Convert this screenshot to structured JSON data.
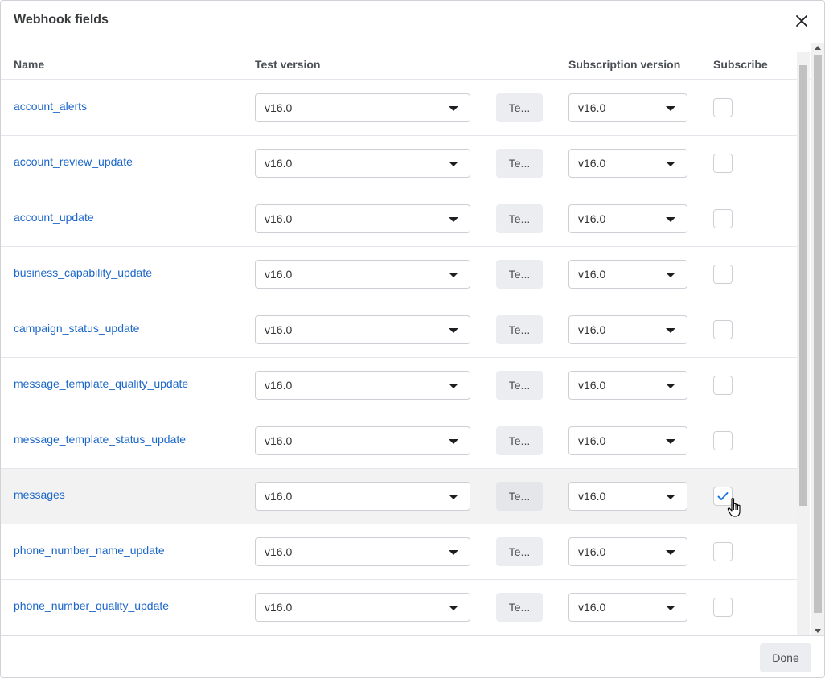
{
  "dialog": {
    "title": "Webhook fields",
    "done_label": "Done"
  },
  "columns": {
    "name": "Name",
    "test_version": "Test version",
    "subscription_version": "Subscription version",
    "subscribe": "Subscribe"
  },
  "rows": [
    {
      "name": "account_alerts",
      "test_version": "v16.0",
      "test_label": "Te...",
      "subscription_version": "v16.0",
      "subscribed": false
    },
    {
      "name": "account_review_update",
      "test_version": "v16.0",
      "test_label": "Te...",
      "subscription_version": "v16.0",
      "subscribed": false
    },
    {
      "name": "account_update",
      "test_version": "v16.0",
      "test_label": "Te...",
      "subscription_version": "v16.0",
      "subscribed": false
    },
    {
      "name": "business_capability_update",
      "test_version": "v16.0",
      "test_label": "Te...",
      "subscription_version": "v16.0",
      "subscribed": false
    },
    {
      "name": "campaign_status_update",
      "test_version": "v16.0",
      "test_label": "Te...",
      "subscription_version": "v16.0",
      "subscribed": false
    },
    {
      "name": "message_template_quality_update",
      "test_version": "v16.0",
      "test_label": "Te...",
      "subscription_version": "v16.0",
      "subscribed": false
    },
    {
      "name": "message_template_status_update",
      "test_version": "v16.0",
      "test_label": "Te...",
      "subscription_version": "v16.0",
      "subscribed": false
    },
    {
      "name": "messages",
      "test_version": "v16.0",
      "test_label": "Te...",
      "subscription_version": "v16.0",
      "subscribed": true,
      "highlighted": true
    },
    {
      "name": "phone_number_name_update",
      "test_version": "v16.0",
      "test_label": "Te...",
      "subscription_version": "v16.0",
      "subscribed": false
    },
    {
      "name": "phone_number_quality_update",
      "test_version": "v16.0",
      "test_label": "Te...",
      "subscription_version": "v16.0",
      "subscribed": false
    }
  ],
  "icons": {
    "close": "close-icon",
    "caret": "caret-down-icon",
    "check": "checkmark-icon",
    "cursor": "hand-pointer-icon"
  },
  "colors": {
    "link": "#1b66c9",
    "check": "#1b74e4",
    "button_bg": "#ebedf0",
    "highlight_row": "#f2f2f2"
  }
}
